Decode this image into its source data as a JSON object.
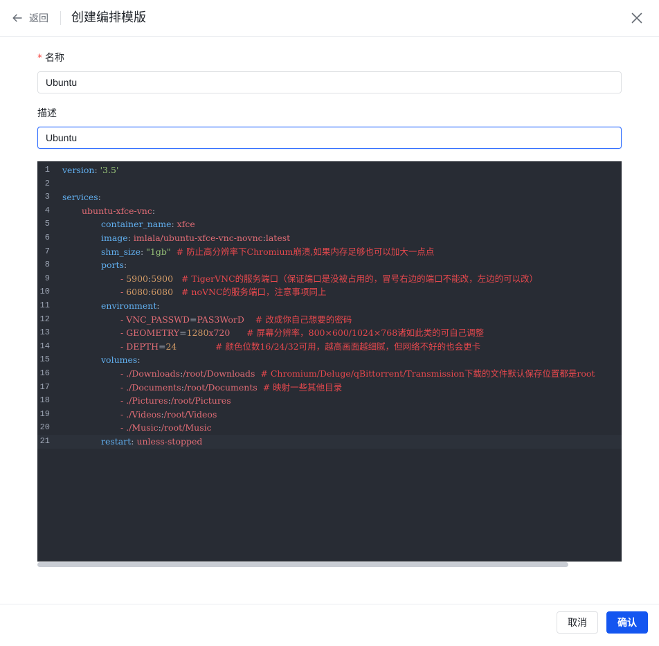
{
  "header": {
    "back_label": "返回",
    "title": "创建编排模版"
  },
  "form": {
    "name_required_mark": "*",
    "name_label": "名称",
    "name_value": "Ubuntu",
    "desc_label": "描述",
    "desc_value": "Ubuntu"
  },
  "editor": {
    "lines": [
      {
        "n": "1"
      },
      {
        "n": "2"
      },
      {
        "n": "3"
      },
      {
        "n": "4"
      },
      {
        "n": "5"
      },
      {
        "n": "6"
      },
      {
        "n": "7"
      },
      {
        "n": "8"
      },
      {
        "n": "9"
      },
      {
        "n": "10"
      },
      {
        "n": "11"
      },
      {
        "n": "12"
      },
      {
        "n": "13"
      },
      {
        "n": "14"
      },
      {
        "n": "15"
      },
      {
        "n": "16"
      },
      {
        "n": "17"
      },
      {
        "n": "18"
      },
      {
        "n": "19"
      },
      {
        "n": "20"
      },
      {
        "n": "21"
      }
    ],
    "tokens": {
      "l1": [
        "version",
        ": ",
        "'3.5'"
      ],
      "l3": [
        "services",
        ":"
      ],
      "l4": [
        "ubuntu-xfce-vnc",
        ":"
      ],
      "l5": [
        "container_name",
        ": ",
        "xfce"
      ],
      "l6": [
        "image",
        ": ",
        "imlala/ubuntu-xfce-vnc-novnc",
        ":",
        "latest"
      ],
      "l7": [
        "shm_size",
        ": ",
        "\"1gb\"",
        "  # 防止高分辨率下Chromium崩溃,如果内存足够也可以加大一点点"
      ],
      "l8": [
        "ports",
        ":"
      ],
      "l9": [
        "- ",
        "5900",
        ":",
        "5900",
        "   # TigerVNC的服务端口（保证端口是没被占用的，冒号右边的端口不能改，左边的可以改）"
      ],
      "l10": [
        "- ",
        "6080",
        ":",
        "6080",
        "   # noVNC的服务端口，注意事项同上"
      ],
      "l11": [
        "environment",
        ":"
      ],
      "l12": [
        "- VNC_PASSWD",
        "=",
        "PAS3WorD",
        "    # 改成你自己想要的密码"
      ],
      "l13": [
        "- GEOMETRY",
        "=",
        "1280",
        "x720",
        "      # 屏幕分辨率，800×600/1024×768诸如此类的可自己调整"
      ],
      "l14": [
        "- DEPTH",
        "=",
        "24",
        "              # 颜色位数16/24/32可用，越高画面越细腻，但网络不好的也会更卡"
      ],
      "l15": [
        "volumes",
        ":"
      ],
      "l16": [
        "- ./Downloads",
        ":",
        "/root/Downloads",
        "  # Chromium/Deluge/qBittorrent/Transmission下载的文件默认保存位置都是root"
      ],
      "l17": [
        "- ./Documents",
        ":",
        "/root/Documents",
        "  # 映射一些其他目录"
      ],
      "l18": [
        "- ./Pictures",
        ":",
        "/root/Pictures"
      ],
      "l19": [
        "- ./Videos",
        ":",
        "/root/Videos"
      ],
      "l20": [
        "- ./Music",
        ":",
        "/root/Music"
      ],
      "l21": [
        "restart",
        ": ",
        "unless-stopped"
      ]
    }
  },
  "footer": {
    "cancel_label": "取消",
    "confirm_label": "确认"
  },
  "colors": {
    "primary": "#1456f0",
    "editor_bg": "#282c34",
    "required": "#f54a45"
  }
}
